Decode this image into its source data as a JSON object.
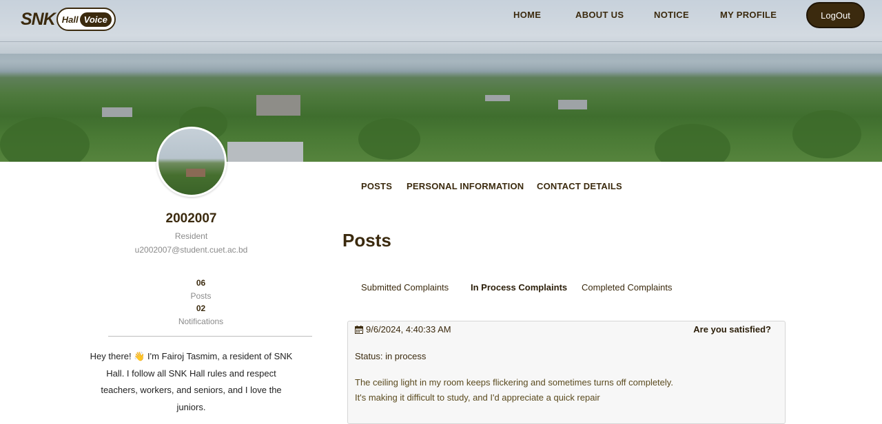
{
  "header": {
    "logo": {
      "snk": "SNK",
      "hall": "Hall",
      "voice": "Voice"
    },
    "nav": [
      "HOME",
      "ABOUT US",
      "NOTICE",
      "MY PROFILE"
    ],
    "logout_label": "LogOut"
  },
  "profile": {
    "id": "2002007",
    "role": "Resident",
    "email": "u2002007@student.cuet.ac.bd",
    "stats": [
      {
        "value": "06",
        "label": "Posts"
      },
      {
        "value": "02",
        "label": "Notifications"
      }
    ],
    "bio": "Hey there! 👋 I'm Fairoj Tasmim, a resident of SNK Hall. I follow all SNK Hall rules and respect teachers, workers, and seniors, and I love the juniors."
  },
  "profile_tabs": [
    "POSTS",
    "PERSONAL INFORMATION",
    "CONTACT DETAILS"
  ],
  "posts": {
    "title": "Posts",
    "tabs": [
      "Submitted Complaints",
      "In Process Complaints",
      "Completed Complaints"
    ],
    "active_tab": "In Process Complaints",
    "items": [
      {
        "date": "9/6/2024, 4:40:33 AM",
        "question": "Are you satisfied?",
        "status": "Status: in process",
        "text_line1": "The ceiling light in my room keeps flickering and sometimes turns off completely.",
        "text_line2": "It's making it difficult to study, and I'd appreciate a quick repair"
      }
    ]
  },
  "colors": {
    "brand": "#3b2a0e",
    "muted": "#8a8a8a",
    "card_bg": "#f7f7f7"
  }
}
